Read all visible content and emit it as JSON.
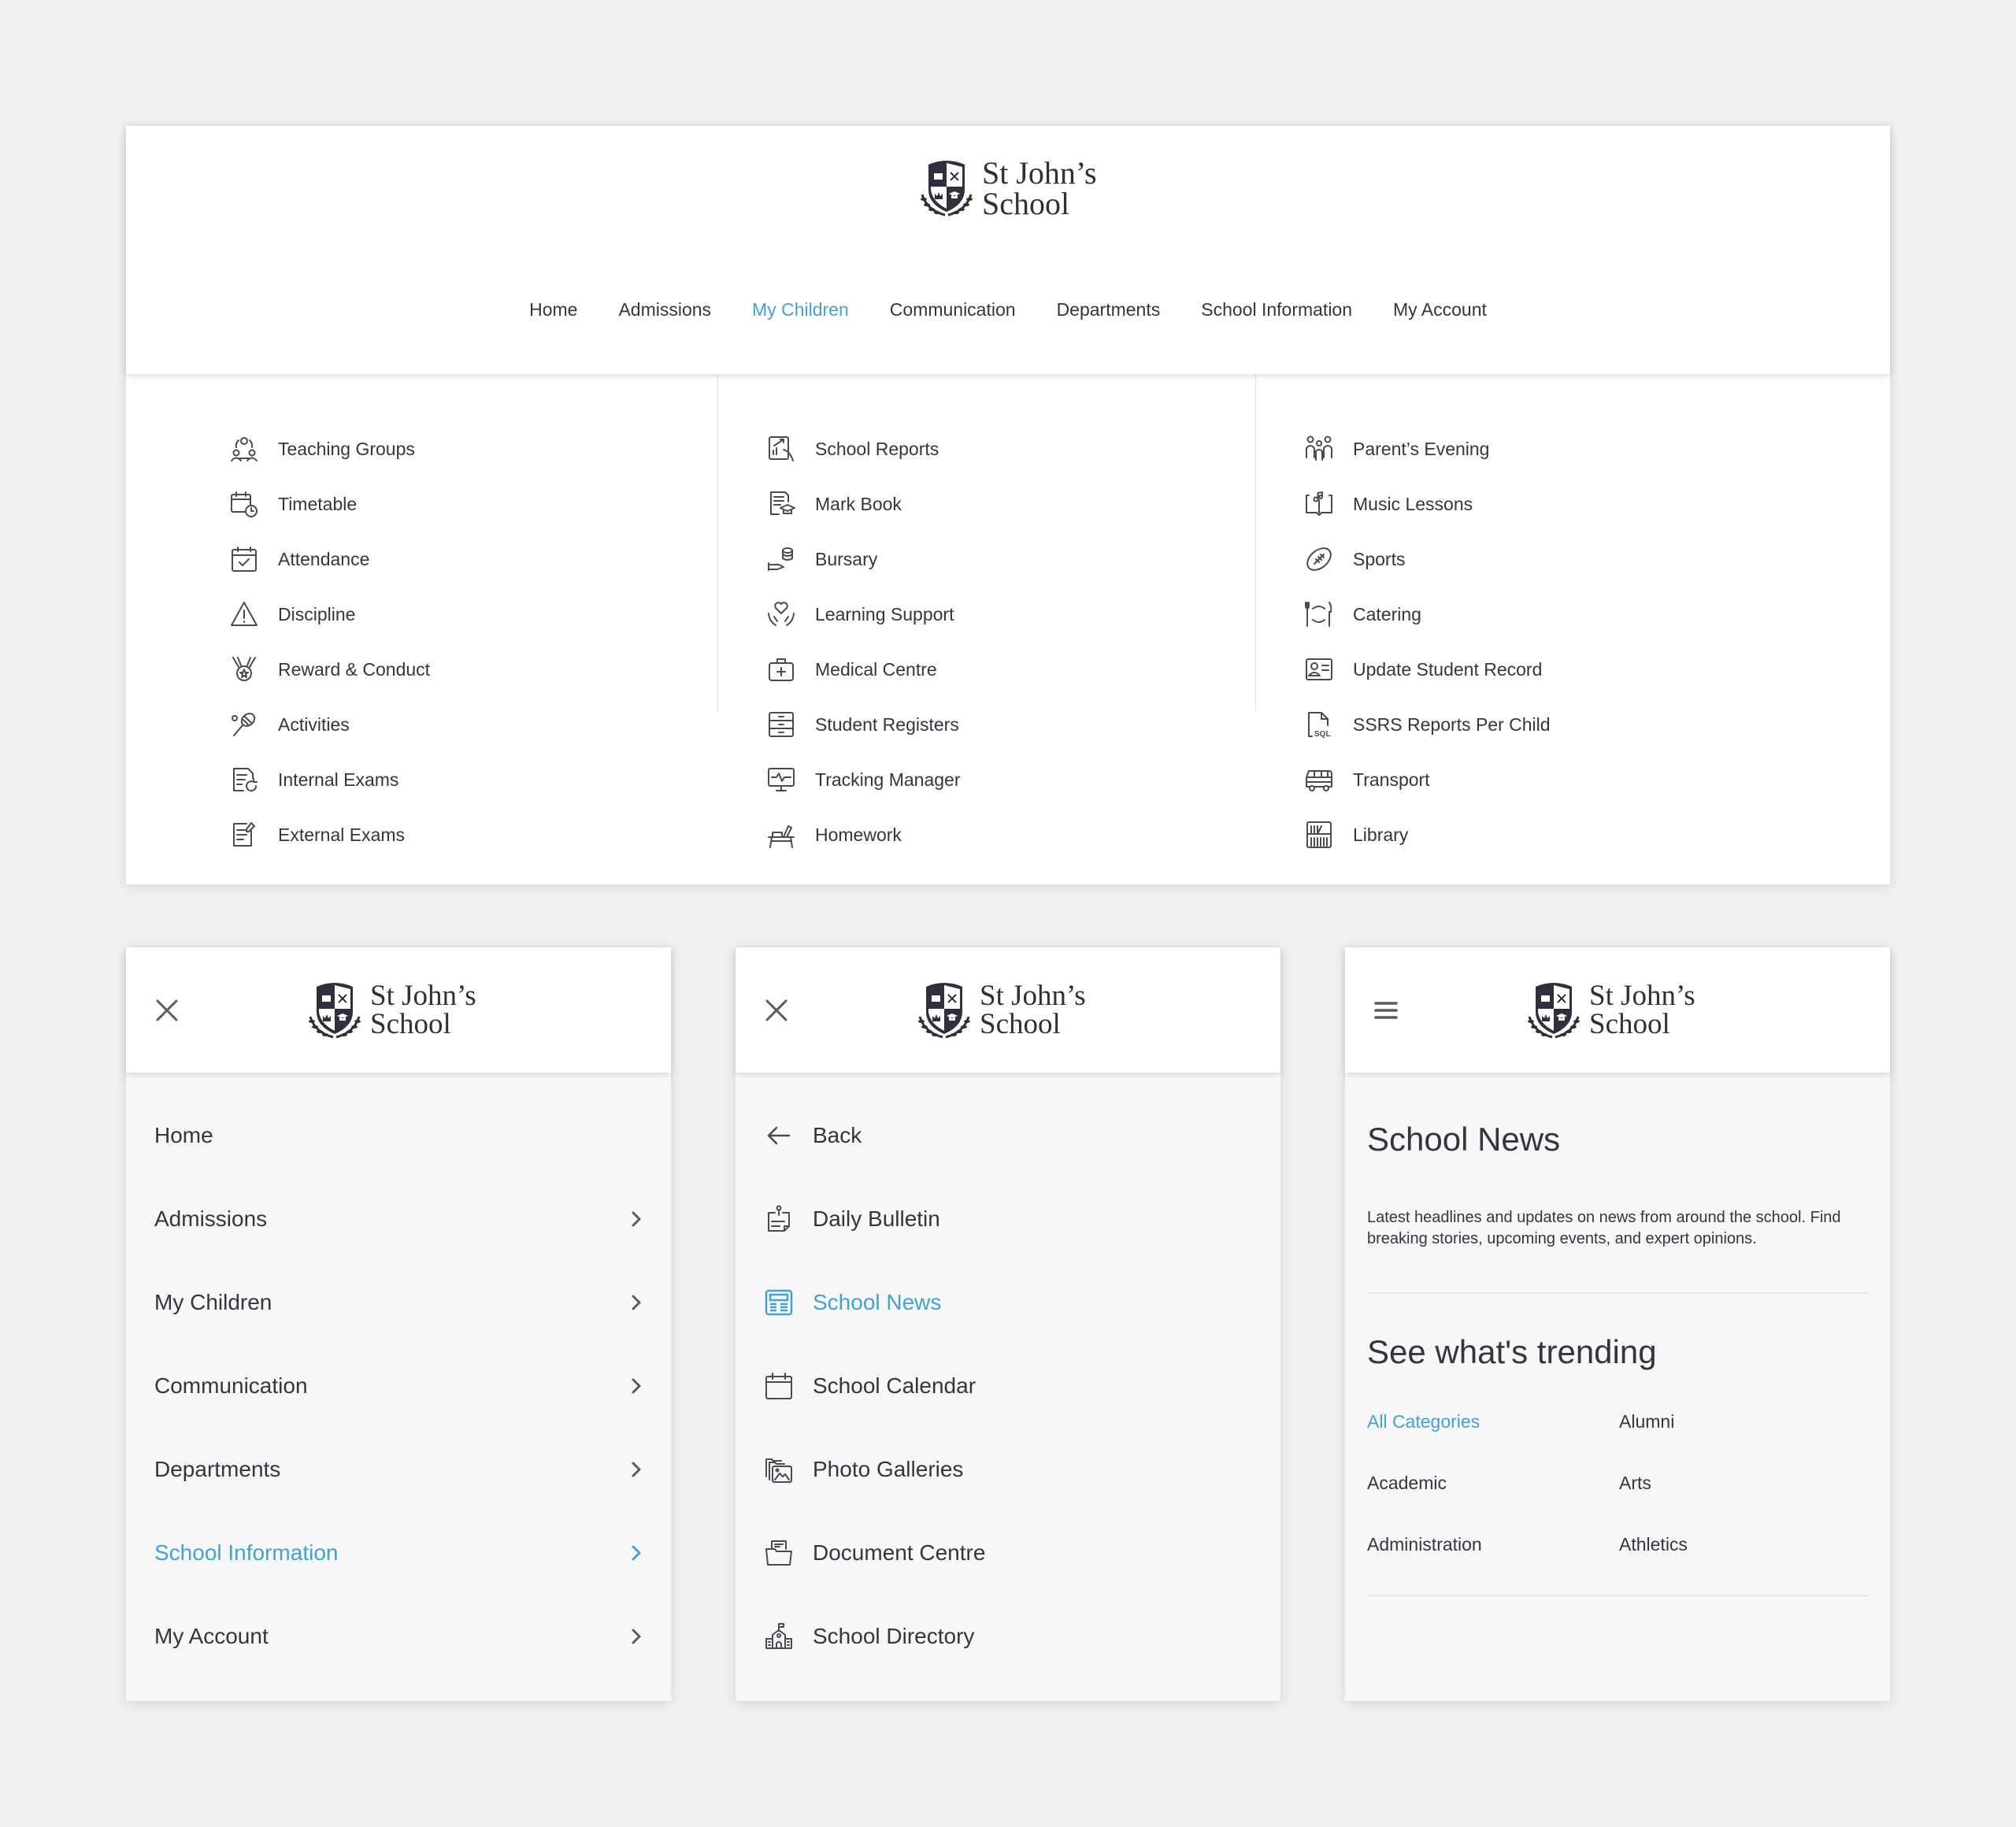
{
  "brand": {
    "line1": "St John’s",
    "line2": "School"
  },
  "colors": {
    "accent": "#44a1d4",
    "text": "#35343f",
    "background": "#f0f0f0"
  },
  "desktop": {
    "nav": [
      {
        "label": "Home",
        "active": false
      },
      {
        "label": "Admissions",
        "active": false
      },
      {
        "label": "My Children",
        "active": true
      },
      {
        "label": "Communication",
        "active": false
      },
      {
        "label": "Departments",
        "active": false
      },
      {
        "label": "School Information",
        "active": false
      },
      {
        "label": "My Account",
        "active": false
      }
    ],
    "mega_menu": {
      "columns": [
        [
          {
            "label": "Teaching Groups",
            "icon": "group-icon"
          },
          {
            "label": "Timetable",
            "icon": "calendar-clock-icon"
          },
          {
            "label": "Attendance",
            "icon": "calendar-check-icon"
          },
          {
            "label": "Discipline",
            "icon": "warning-icon"
          },
          {
            "label": "Reward & Conduct",
            "icon": "medal-icon"
          },
          {
            "label": "Activities",
            "icon": "racket-icon"
          },
          {
            "label": "Internal Exams",
            "icon": "exam-refresh-icon"
          },
          {
            "label": "External Exams",
            "icon": "exam-pen-icon"
          }
        ],
        [
          {
            "label": "School Reports",
            "icon": "report-chart-icon"
          },
          {
            "label": "Mark Book",
            "icon": "markbook-icon"
          },
          {
            "label": "Bursary",
            "icon": "coins-hand-icon"
          },
          {
            "label": "Learning Support",
            "icon": "heart-hands-icon"
          },
          {
            "label": "Medical Centre",
            "icon": "medical-kit-icon"
          },
          {
            "label": "Student Registers",
            "icon": "cabinet-icon"
          },
          {
            "label": "Tracking Manager",
            "icon": "monitor-pulse-icon"
          },
          {
            "label": "Homework",
            "icon": "desk-icon"
          }
        ],
        [
          {
            "label": "Parent’s Evening",
            "icon": "family-icon"
          },
          {
            "label": "Music Lessons",
            "icon": "music-book-icon"
          },
          {
            "label": "Sports",
            "icon": "football-icon"
          },
          {
            "label": "Catering",
            "icon": "plate-cutlery-icon"
          },
          {
            "label": "Update Student Record",
            "icon": "id-card-icon"
          },
          {
            "label": "SSRS Reports Per Child",
            "icon": "sql-file-icon"
          },
          {
            "label": "Transport",
            "icon": "bus-icon"
          },
          {
            "label": "Library",
            "icon": "library-icon"
          }
        ]
      ]
    }
  },
  "mobile_menu": {
    "header_icon": "close-icon",
    "items": [
      {
        "label": "Home",
        "has_submenu": false,
        "active": false
      },
      {
        "label": "Admissions",
        "has_submenu": true,
        "active": false
      },
      {
        "label": "My Children",
        "has_submenu": true,
        "active": false
      },
      {
        "label": "Communication",
        "has_submenu": true,
        "active": false
      },
      {
        "label": "Departments",
        "has_submenu": true,
        "active": false
      },
      {
        "label": "School Information",
        "has_submenu": true,
        "active": true
      },
      {
        "label": "My Account",
        "has_submenu": true,
        "active": false
      }
    ]
  },
  "mobile_submenu": {
    "header_icon": "close-icon",
    "back_label": "Back",
    "items": [
      {
        "label": "Daily Bulletin",
        "icon": "bulletin-icon",
        "active": false
      },
      {
        "label": "School News",
        "icon": "newspaper-icon",
        "active": true
      },
      {
        "label": "School Calendar",
        "icon": "calendar-icon",
        "active": false
      },
      {
        "label": "Photo Galleries",
        "icon": "gallery-icon",
        "active": false
      },
      {
        "label": "Document Centre",
        "icon": "document-folder-icon",
        "active": false
      },
      {
        "label": "School Directory",
        "icon": "school-building-icon",
        "active": false
      }
    ]
  },
  "mobile_news": {
    "header_icon": "hamburger-icon",
    "title": "School News",
    "description": "Latest headlines and updates on news from around the school. Find breaking stories, upcoming events, and expert opinions.",
    "trending_title": "See what's trending",
    "categories": [
      {
        "label": "All Categories",
        "active": true
      },
      {
        "label": "Alumni",
        "active": false
      },
      {
        "label": "Academic",
        "active": false
      },
      {
        "label": "Arts",
        "active": false
      },
      {
        "label": "Administration",
        "active": false
      },
      {
        "label": "Athletics",
        "active": false
      }
    ]
  }
}
